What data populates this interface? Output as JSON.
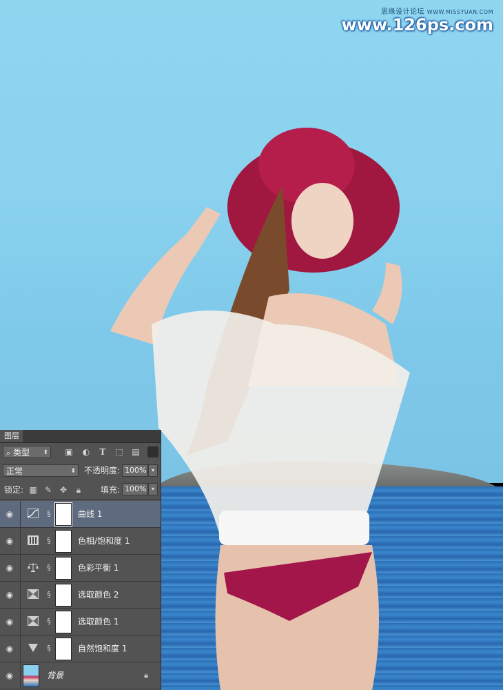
{
  "watermark": {
    "site_cn": "思缘设计论坛",
    "site_url_small": "WWW.MISSYUAN.COM",
    "site_url_big": "www.126ps.com"
  },
  "layers_panel": {
    "tab_label": "图层",
    "filter": {
      "kind_label": "类型"
    },
    "blend_mode": "正常",
    "opacity_label": "不透明度:",
    "opacity_value": "100%",
    "lock_label": "锁定:",
    "fill_label": "填充:",
    "fill_value": "100%",
    "layers": [
      {
        "name": "曲线 1",
        "icon": "curves-icon",
        "selected": true,
        "visible": true
      },
      {
        "name": "色相/饱和度 1",
        "icon": "hue-saturation-icon",
        "selected": false,
        "visible": true
      },
      {
        "name": "色彩平衡 1",
        "icon": "color-balance-icon",
        "selected": false,
        "visible": true
      },
      {
        "name": "选取颜色 2",
        "icon": "selective-color-icon",
        "selected": false,
        "visible": true
      },
      {
        "name": "选取颜色 1",
        "icon": "selective-color-icon",
        "selected": false,
        "visible": true
      },
      {
        "name": "自然饱和度 1",
        "icon": "vibrance-icon",
        "selected": false,
        "visible": true
      },
      {
        "name": "背景",
        "icon": "image-thumbnail",
        "selected": false,
        "visible": true,
        "locked": true
      }
    ]
  },
  "colors": {
    "panel_bg": "#535353",
    "selected_row": "#5e6b7e",
    "sky": "#8ad2ee",
    "sea": "#2f74b8"
  }
}
